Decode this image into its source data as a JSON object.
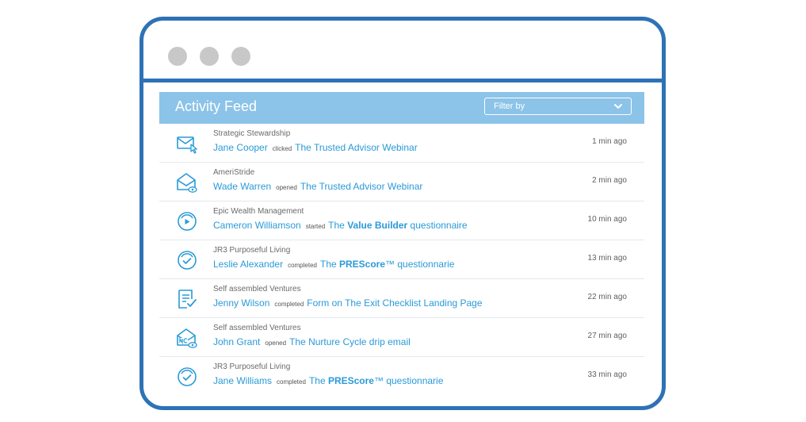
{
  "header": {
    "title": "Activity Feed",
    "filter": {
      "label": "Filter by"
    }
  },
  "colors": {
    "frame": "#2e72b6",
    "header_bg": "#8cc3e8",
    "accent": "#2a9ad8"
  },
  "feed": [
    {
      "icon": "email-click-icon",
      "org": "Strategic Stewardship",
      "person": "Jane Cooper",
      "action": "clicked",
      "target_pre": "The Trusted Advisor Webinar",
      "target_bold": "",
      "target_post": "",
      "time": "1 min ago"
    },
    {
      "icon": "email-open-icon",
      "org": "AmeriStride",
      "person": "Wade Warren",
      "action": "opened",
      "target_pre": "The Trusted Advisor Webinar",
      "target_bold": "",
      "target_post": "",
      "time": "2 min ago"
    },
    {
      "icon": "questionnaire-start-icon",
      "org": "Epic Wealth Management",
      "person": "Cameron Williamson",
      "action": "started",
      "target_pre": "The ",
      "target_bold": "Value Builder",
      "target_post": " questionnaire",
      "time": "10 min ago"
    },
    {
      "icon": "questionnaire-complete-icon",
      "org": "JR3 Purposeful Living",
      "person": "Leslie Alexander",
      "action": "completed",
      "target_pre": "The ",
      "target_bold": "PREScore",
      "target_post": "™ questionnarie",
      "time": "13 min ago"
    },
    {
      "icon": "form-complete-icon",
      "org": "Self assembled Ventures",
      "person": "Jenny Wilson",
      "action": "completed",
      "target_pre": "Form on The Exit Checklist Landing Page",
      "target_bold": "",
      "target_post": "",
      "time": "22 min ago"
    },
    {
      "icon": "nurture-email-open-icon",
      "org": "Self assembled Ventures",
      "person": "John Grant",
      "action": "opened",
      "target_pre": "The Nurture Cycle drip email",
      "target_bold": "",
      "target_post": "",
      "time": "27 min ago"
    },
    {
      "icon": "questionnaire-complete-icon",
      "org": "JR3 Purposeful Living",
      "person": "Jane Williams",
      "action": "completed",
      "target_pre": "The ",
      "target_bold": "PREScore",
      "target_post": "™ questionnarie",
      "time": "33 min ago"
    }
  ]
}
